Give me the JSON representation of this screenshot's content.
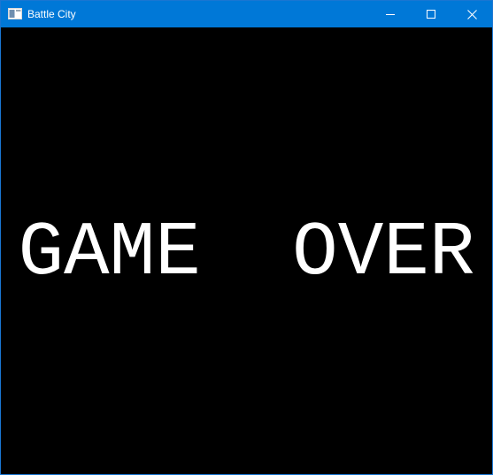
{
  "window": {
    "title": "Battle City",
    "accent_color": "#0078d7",
    "controls": {
      "minimize_icon": "minimize-icon",
      "maximize_icon": "maximize-icon",
      "close_icon": "close-icon"
    }
  },
  "game": {
    "message": "GAME  OVER",
    "background_color": "#000000",
    "text_color": "#ffffff"
  }
}
